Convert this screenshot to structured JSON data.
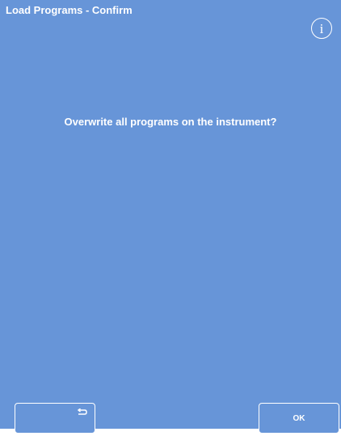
{
  "header": {
    "title": "Load Programs - Confirm",
    "info_icon": "info-icon",
    "info_glyph": "i"
  },
  "dialog": {
    "message": "Overwrite all programs on the instrument?"
  },
  "footer": {
    "back_icon": "return-arrow-icon",
    "ok_label": "OK"
  },
  "colors": {
    "background": "#6795d8",
    "foreground": "#ffffff"
  }
}
